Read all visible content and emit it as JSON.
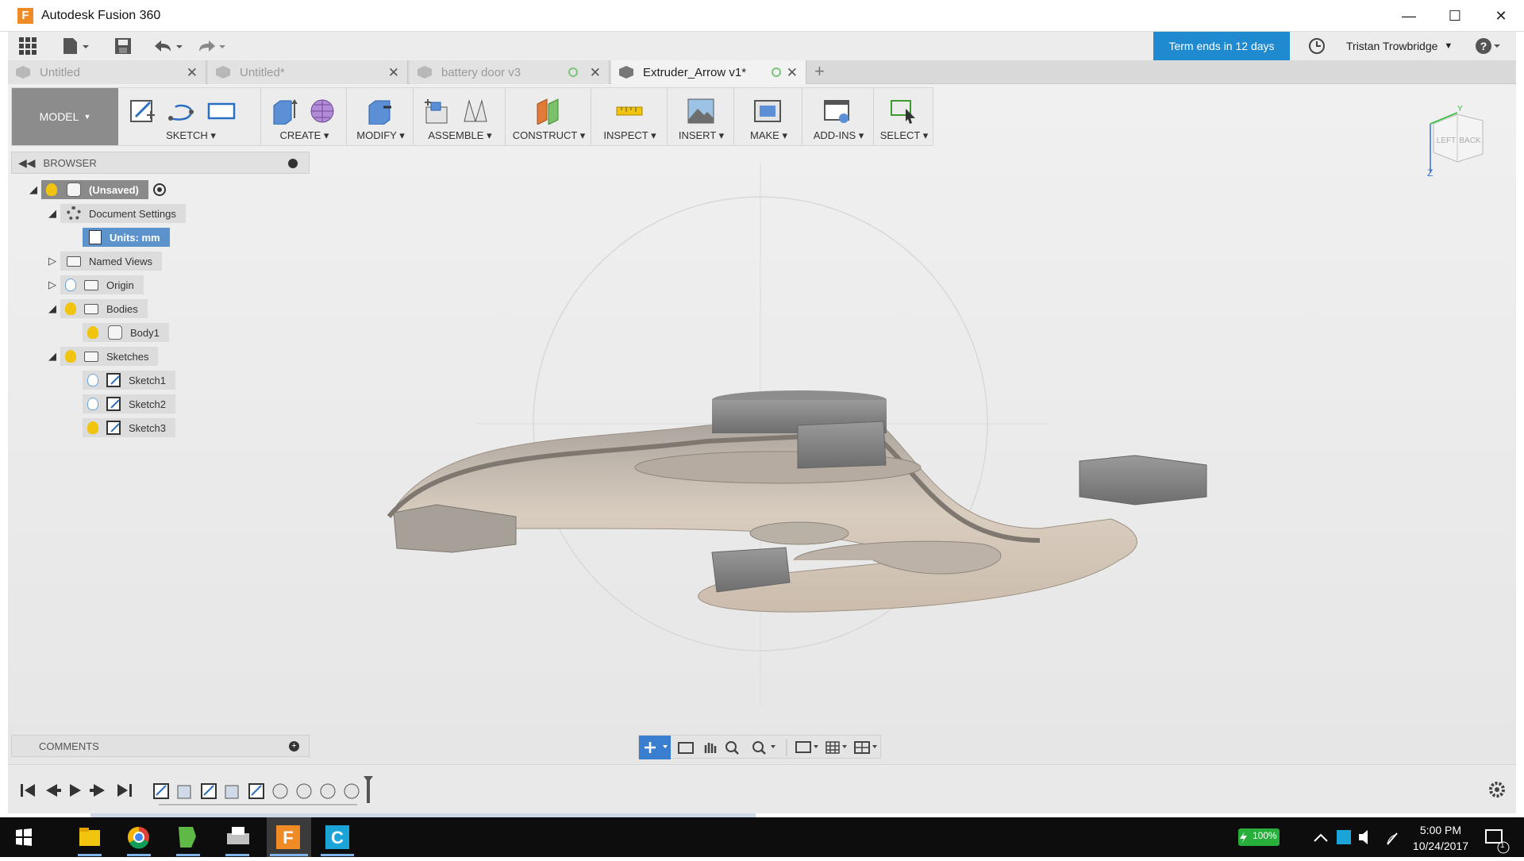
{
  "window": {
    "title": "Autodesk Fusion 360",
    "logo_letter": "F"
  },
  "appbar": {
    "term_label": "Term ends in 12 days",
    "user_name": "Tristan Trowbridge"
  },
  "tabs": [
    {
      "label": "Untitled",
      "active": false
    },
    {
      "label": "Untitled*",
      "active": false
    },
    {
      "label": "battery door v3",
      "active": false
    },
    {
      "label": "Extruder_Arrow v1*",
      "active": true
    }
  ],
  "toolbar": {
    "workspace": "MODEL",
    "groups": [
      "SKETCH",
      "CREATE",
      "MODIFY",
      "ASSEMBLE",
      "CONSTRUCT",
      "INSPECT",
      "INSERT",
      "MAKE",
      "ADD-INS",
      "SELECT"
    ]
  },
  "browser": {
    "title": "BROWSER",
    "root": "(Unsaved)",
    "items": {
      "document_settings": "Document Settings",
      "units": "Units: mm",
      "named_views": "Named Views",
      "origin": "Origin",
      "bodies": "Bodies",
      "body1": "Body1",
      "sketches": "Sketches",
      "sketch1": "Sketch1",
      "sketch2": "Sketch2",
      "sketch3": "Sketch3"
    }
  },
  "viewcube": {
    "face_left": "LEFT",
    "face_back": "BACK",
    "axis_z": "Z",
    "axis_y": "Y"
  },
  "comments": {
    "title": "COMMENTS"
  },
  "taskbar": {
    "battery": "100%",
    "time": "5:00 PM",
    "date": "10/24/2017",
    "notification_count": "1"
  },
  "colors": {
    "accent": "#1f8ad0",
    "workspace_bg": "#8c8c8c",
    "bulb_on": "#f1c40f",
    "body": "#cbbcac"
  }
}
